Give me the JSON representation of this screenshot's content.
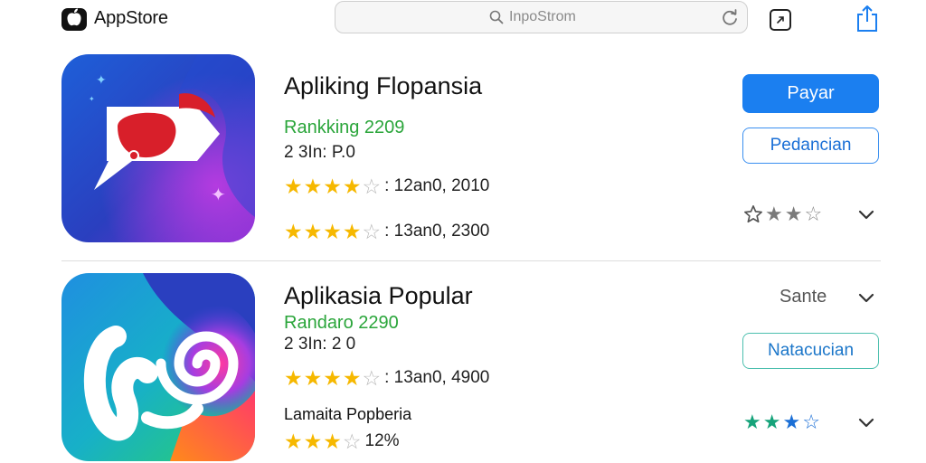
{
  "header": {
    "brand_label": "AppStore",
    "search_text": "InpoStrom",
    "icons": [
      "apple-logo-icon",
      "search-icon",
      "reload-icon",
      "tabs-icon",
      "share-icon"
    ]
  },
  "apps": [
    {
      "title": "Apliking Flopansia",
      "ranking": "Rankking 2209",
      "meta": "2 3In: P.0",
      "rating_lines": [
        {
          "full": 4,
          "empty": 1,
          "text": ": 12an0, 2010"
        },
        {
          "full": 4,
          "empty": 1,
          "text": ": 13an0, 2300"
        }
      ],
      "primary_button": "Payar",
      "secondary_button": "Pedancian",
      "mini_rating": {
        "full": 2,
        "empty": 2
      }
    },
    {
      "title": "Aplikasia Popular",
      "ranking": "Randaro 2290",
      "meta": "2 3In: 2 0",
      "sort_label": "Sante",
      "rating_lines": [
        {
          "full": 4,
          "empty": 1,
          "text": ": 13an0, 4900"
        },
        {
          "full": 3,
          "empty": 1,
          "text": " 12%"
        }
      ],
      "sub_label": "Lamaita Popberia",
      "secondary_button": "Natacucian",
      "mini_rating": {
        "full": 3,
        "empty": 1
      }
    }
  ],
  "colors": {
    "accent_blue": "#1b7ff0",
    "ranking_green": "#2aa53a",
    "star_gold": "#f6b800",
    "mini_star_green": "#16a37a"
  }
}
